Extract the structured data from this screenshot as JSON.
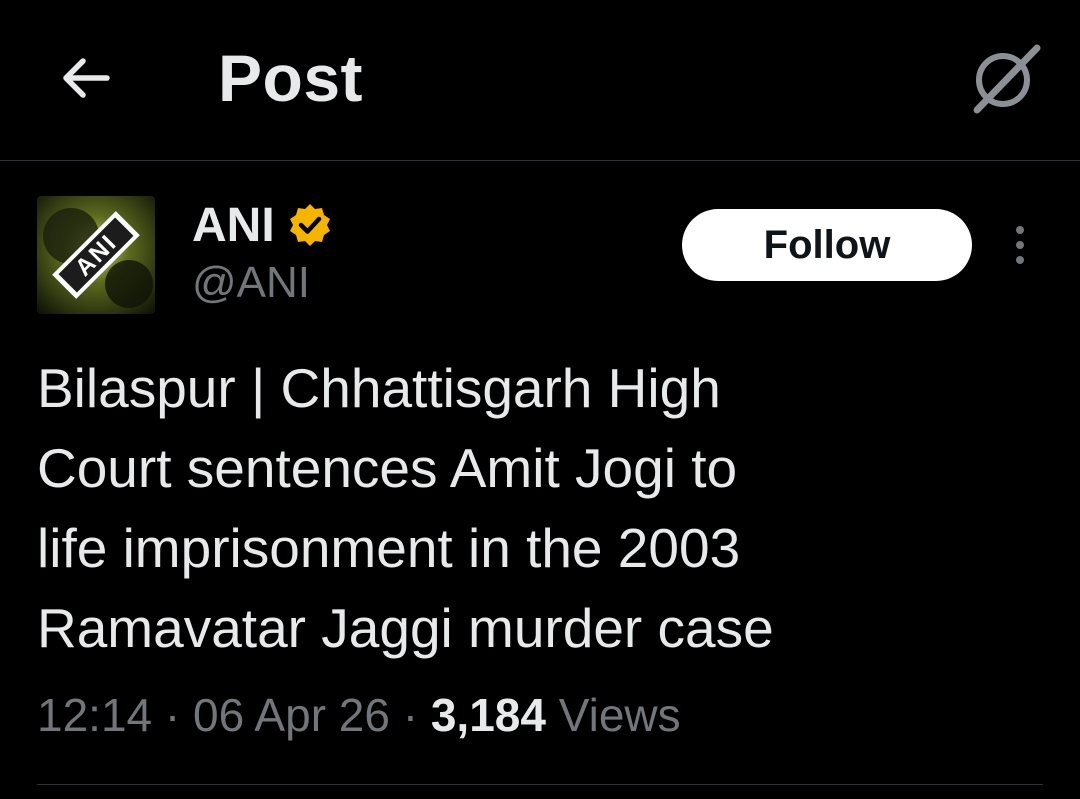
{
  "header": {
    "title": "Post",
    "back_icon": "arrow-left-icon",
    "grok_icon": "grok-icon"
  },
  "author": {
    "display_name": "ANI",
    "handle": "@ANI",
    "avatar_text": "ANI",
    "verified_color": "#f4b400",
    "follow_label": "Follow"
  },
  "post": {
    "text": "Bilaspur | Chhattisgarh High\nCourt sentences Amit Jogi to\nlife imprisonment in the 2003\nRamavatar Jaggi murder case",
    "time": "12:14",
    "separator": "·",
    "date": "06 Apr 26",
    "views_count": "3,184",
    "views_label": "Views"
  },
  "colors": {
    "background": "#000000",
    "primary_text": "#e7e9ea",
    "secondary_text": "#71767b",
    "divider": "#2f3336"
  }
}
